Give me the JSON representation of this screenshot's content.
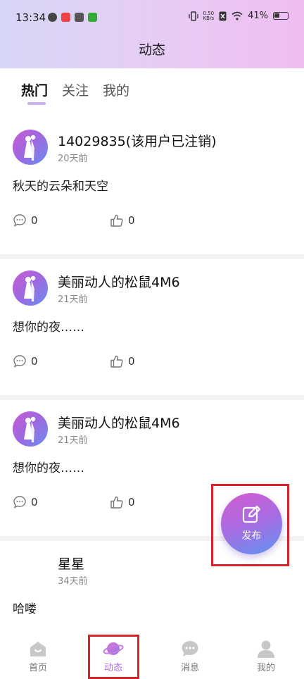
{
  "status_bar": {
    "time": "13:34",
    "net_speed_value": "0.50",
    "net_speed_unit": "KB/s",
    "battery": "41%"
  },
  "header": {
    "title": "动态"
  },
  "tabs": [
    {
      "label": "热门",
      "active": true
    },
    {
      "label": "关注",
      "active": false
    },
    {
      "label": "我的",
      "active": false
    }
  ],
  "posts": [
    {
      "username": "14029835(该用户已注销)",
      "time": "20天前",
      "content": "秋天的云朵和天空",
      "comments": "0",
      "likes": "0"
    },
    {
      "username": "美丽动人的松鼠4M6",
      "time": "21天前",
      "content": "想你的夜……",
      "comments": "0",
      "likes": "0"
    },
    {
      "username": "美丽动人的松鼠4M6",
      "time": "21天前",
      "content": "想你的夜……",
      "comments": "0",
      "likes": "0"
    },
    {
      "username": "星星",
      "time": "34天前",
      "content": "哈喽",
      "comments": "",
      "likes": ""
    }
  ],
  "fab": {
    "label": "发布",
    "icon": "edit-icon"
  },
  "bottom_nav": [
    {
      "label": "首页",
      "icon": "home-icon",
      "active": false
    },
    {
      "label": "动态",
      "icon": "planet-icon",
      "active": true
    },
    {
      "label": "消息",
      "icon": "chat-icon",
      "active": false
    },
    {
      "label": "我的",
      "icon": "person-icon",
      "active": false
    }
  ],
  "colors": {
    "accent": "#b06ce0",
    "header_gradient_start": "#d7d6f6",
    "header_gradient_end": "#efbdf2",
    "highlight_frame": "#d8232a"
  }
}
